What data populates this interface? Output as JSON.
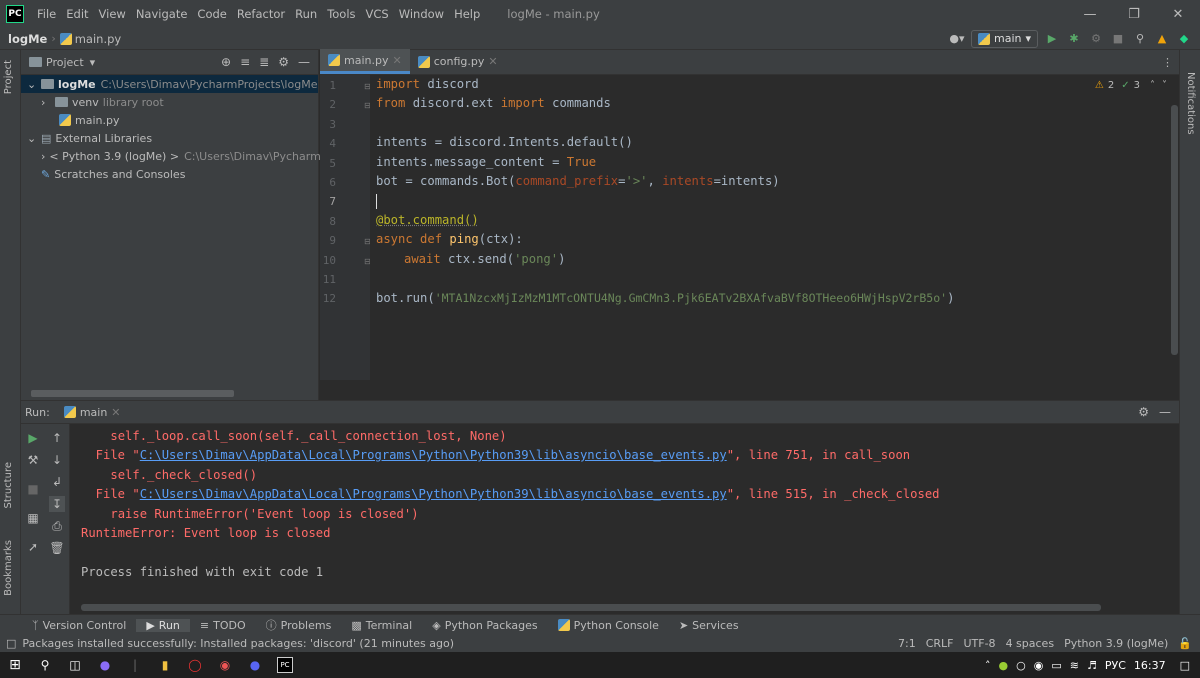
{
  "menu": [
    "File",
    "Edit",
    "View",
    "Navigate",
    "Code",
    "Refactor",
    "Run",
    "Tools",
    "VCS",
    "Window",
    "Help"
  ],
  "window_title": "logMe - main.py",
  "breadcrumb": {
    "project": "logMe",
    "file": "main.py"
  },
  "branch": "main",
  "left_tabs": {
    "project": "Project",
    "structure": "Structure",
    "bookmarks": "Bookmarks"
  },
  "right_tabs": {
    "notifications": "Notifications"
  },
  "project_panel": {
    "title": "Project",
    "root_name": "logMe",
    "root_path": "C:\\Users\\Dimav\\PycharmProjects\\logMe",
    "venv": "venv",
    "venv_note": "library root",
    "main_file": "main.py",
    "external": "External Libraries",
    "python_sdk": "< Python 3.9 (logMe) >",
    "python_path": "C:\\Users\\Dimav\\PycharmPro",
    "scratches": "Scratches and Consoles"
  },
  "editor_tabs": [
    "main.py",
    "config.py"
  ],
  "inspection": {
    "warnings": "2",
    "weak": "3"
  },
  "line_numbers": [
    "1",
    "2",
    "3",
    "4",
    "5",
    "6",
    "7",
    "8",
    "9",
    "10",
    "11",
    "12"
  ],
  "code": {
    "l1_kw": "import",
    "l1_rest": " discord",
    "l2_kw1": "from",
    "l2_mid": " discord.ext ",
    "l2_kw2": "import",
    "l2_rest": " commands",
    "l4": "intents = discord.Intents.default()",
    "l5_a": "intents.message_content = ",
    "l5_kw": "True",
    "l6_a": "bot = commands.Bot(",
    "l6_p1": "command_prefix",
    "l6_eq": "=",
    "l6_s": "'>'",
    "l6_c": ", ",
    "l6_p2": "intents",
    "l6_end": "=intents)",
    "l8": "@bot.command()",
    "l9_kw": "async def",
    "l9_fn": "ping",
    "l9_rest": "(ctx):",
    "l10_kw": "await",
    "l10_a": " ctx.send(",
    "l10_s": "'pong'",
    "l10_end": ")",
    "l12_a": "bot.run(",
    "l12_s": "'MTA1NzcxMjIzMzM1MTcONTU4Ng.GmCMn3.Pjk6EATv2BXAfvaBVf8OTHeeo6HWjHspV2rB5o'",
    "l12_end": ")"
  },
  "run_panel": {
    "label": "Run:",
    "config": "main",
    "lines": [
      {
        "indent": "    ",
        "text": "self._loop.call_soon(self._call_connection_lost, None)"
      },
      {
        "pre": "  File \"",
        "link": "C:\\Users\\Dimav\\AppData\\Local\\Programs\\Python\\Python39\\lib\\asyncio\\base_events.py",
        "post": "\", line 751, in call_soon"
      },
      {
        "indent": "    ",
        "text": "self._check_closed()"
      },
      {
        "pre": "  File \"",
        "link": "C:\\Users\\Dimav\\AppData\\Local\\Programs\\Python\\Python39\\lib\\asyncio\\base_events.py",
        "post": "\", line 515, in _check_closed"
      },
      {
        "indent": "    ",
        "text": "raise RuntimeError('Event loop is closed')"
      },
      {
        "indent": "",
        "text": "RuntimeError: Event loop is closed"
      }
    ],
    "finished": "Process finished with exit code 1"
  },
  "bottom_tabs": [
    "Version Control",
    "Run",
    "TODO",
    "Problems",
    "Terminal",
    "Python Packages",
    "Python Console",
    "Services"
  ],
  "status": {
    "message": "Packages installed successfully: Installed packages: 'discord' (21 minutes ago)",
    "position": "7:1",
    "line_sep": "CRLF",
    "encoding": "UTF-8",
    "indent": "4 spaces",
    "interpreter": "Python 3.9 (logMe)"
  },
  "taskbar": {
    "lang": "РУС",
    "time": "16:37"
  }
}
